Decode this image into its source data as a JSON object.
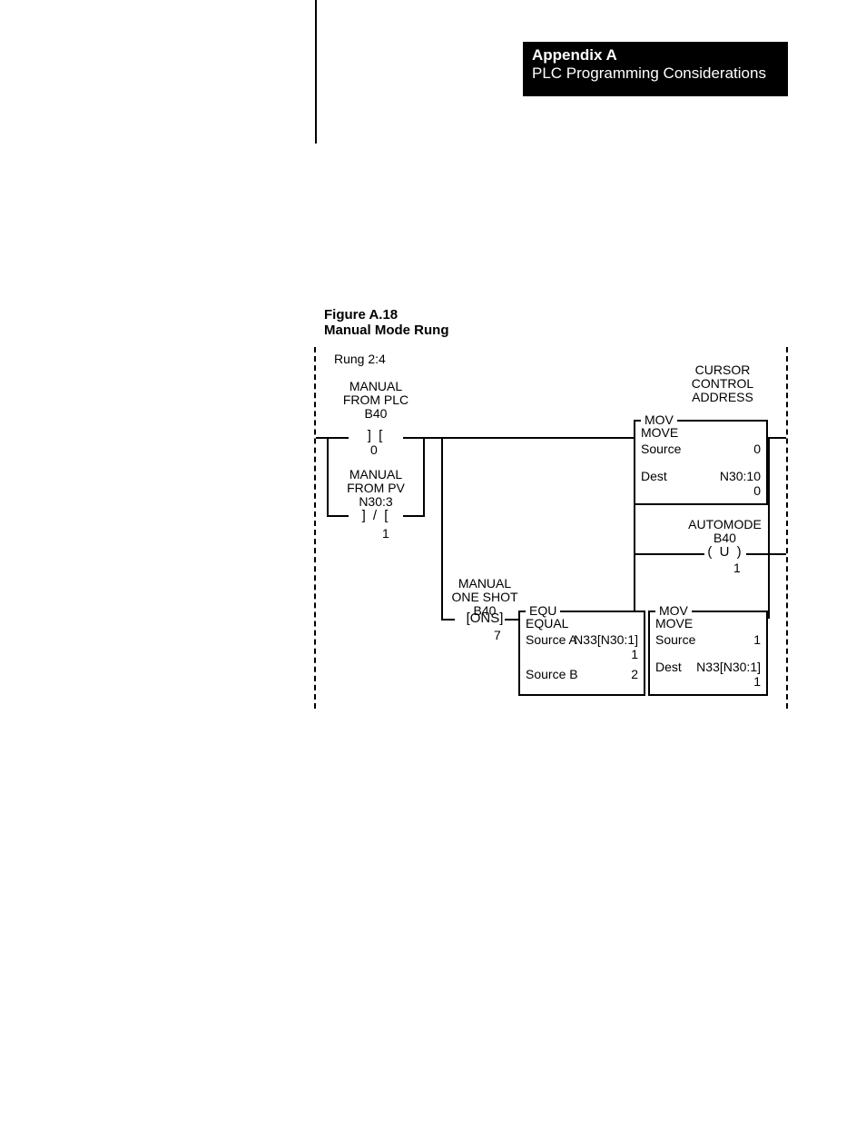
{
  "header": {
    "line1": "Appendix A",
    "line2": "PLC Programming Considerations"
  },
  "figure": {
    "number": "Figure A.18",
    "caption": "Manual Mode Rung"
  },
  "rung_label": "Rung 2:4",
  "inputs": {
    "xio": {
      "line1": "MANUAL",
      "line2": "FROM PLC",
      "line3": "B40",
      "symbol": "]  [",
      "bit": "0"
    },
    "xic": {
      "line1": "MANUAL",
      "line2": "FROM PV",
      "line3": "N30:3",
      "symbol": "] / [",
      "bit": "1"
    },
    "ons": {
      "line1": "MANUAL",
      "line2": "ONE SHOT",
      "line3": "B40",
      "symbol": "[ONS]",
      "bit": "7"
    }
  },
  "mov1": {
    "header_label": "CURSOR CONTROL ADDRESS",
    "title": "MOV",
    "name": "MOVE",
    "src_label": "Source",
    "src_val": "0",
    "dst_label": "Dest",
    "dst_val": "N30:10",
    "dst_sub": "0"
  },
  "coil": {
    "label1": "AUTOMODE",
    "label2": "B40",
    "symbol": "( U )",
    "bit": "1"
  },
  "equ": {
    "title": "EQU",
    "name": "EQUAL",
    "a_label": "Source A",
    "a_val": "N33[N30:1]",
    "a_sub": "1",
    "b_label": "Source B",
    "b_val": "2"
  },
  "mov2": {
    "title": "MOV",
    "name": "MOVE",
    "src_label": "Source",
    "src_val": "1",
    "dst_label": "Dest",
    "dst_val": "N33[N30:1]",
    "dst_sub": "1"
  }
}
